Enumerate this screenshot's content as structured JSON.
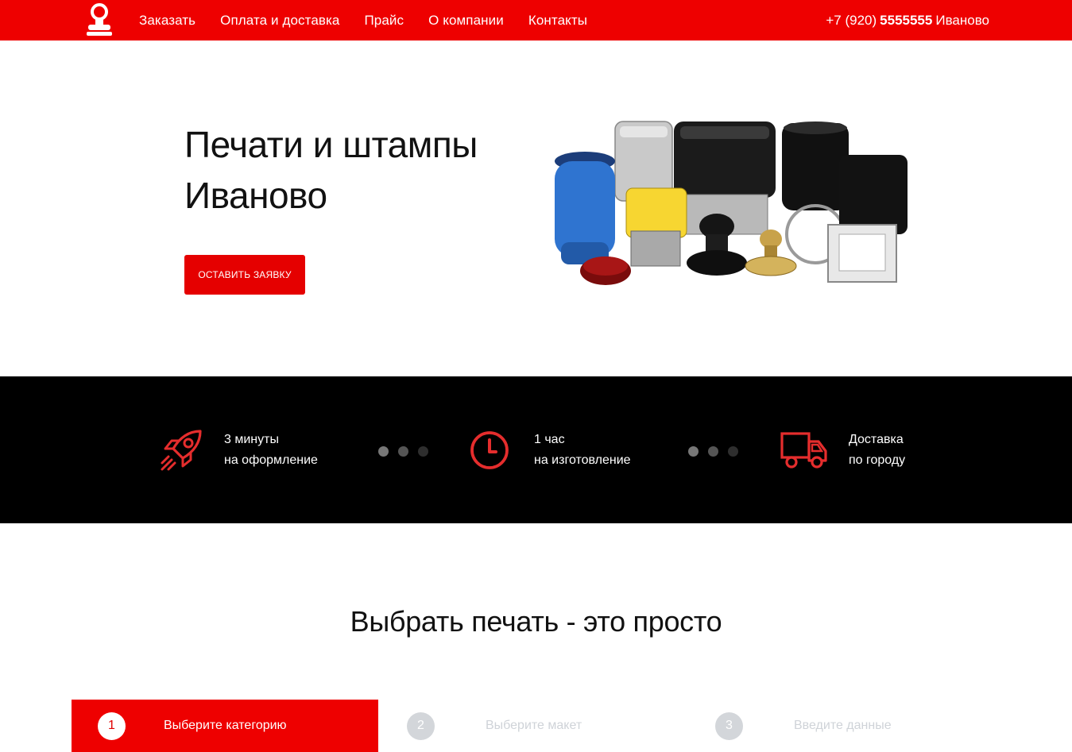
{
  "header": {
    "nav": [
      "Заказать",
      "Оплата и доставка",
      "Прайс",
      "О компании",
      "Контакты"
    ],
    "phone_prefix": "+7 (920)",
    "phone_number": "5555555",
    "phone_city": "Иваново",
    "logo_icon": "stamp-icon"
  },
  "hero": {
    "title_line1": "Печати и штампы",
    "title_line2": "Иваново",
    "cta_label": "ОСТАВИТЬ ЗАЯВКУ",
    "image": "stamps-product-photo"
  },
  "features": [
    {
      "icon": "rocket-icon",
      "line1": "3 минуты",
      "line2": "на оформление"
    },
    {
      "icon": "clock-icon",
      "line1": "1 час",
      "line2": "на изготовление"
    },
    {
      "icon": "truck-icon",
      "line1": "Доставка",
      "line2": "по городу"
    }
  ],
  "section": {
    "title": "Выбрать печать - это просто"
  },
  "steps": [
    {
      "number": "1",
      "label": "Выберите категорию",
      "active": true
    },
    {
      "number": "2",
      "label": "Выберите макет",
      "active": false
    },
    {
      "number": "3",
      "label": "Введите данные",
      "active": false
    }
  ],
  "colors": {
    "accent": "#ee0000",
    "band": "#000000",
    "inactive_text": "#cfd3d8",
    "inactive_circle": "#d3d6da"
  }
}
